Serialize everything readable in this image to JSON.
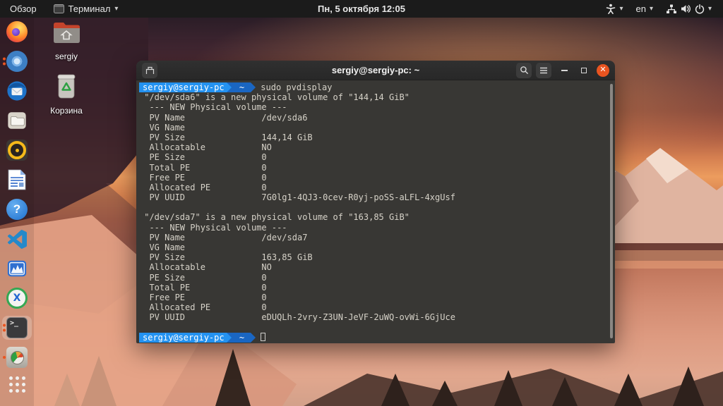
{
  "colors": {
    "accent_orange": "#e95420",
    "prompt_blue_1": "#2492f0",
    "prompt_blue_2": "#1a66c2",
    "terminal_bg": "#383734",
    "topbar_bg": "#1b1b1b"
  },
  "top_bar": {
    "activities_label": "Обзор",
    "focused_app": {
      "icon": "terminal-window-icon",
      "label": "Терминал",
      "caret": "▾"
    },
    "clock": "Пн, 5 октября 12:05",
    "tray": {
      "accessibility_icon": "accessibility-person-icon",
      "accessibility_caret": "▾",
      "language": "en",
      "language_caret": "▾",
      "system_icons": [
        "network-icon",
        "volume-icon",
        "power-icon"
      ],
      "system_caret": "▾"
    }
  },
  "desktop": {
    "icons": [
      {
        "label": "sergiy",
        "icon": "home-folder-icon"
      },
      {
        "label": "Корзина",
        "icon": "trash-icon"
      }
    ]
  },
  "dock": {
    "items": [
      {
        "name": "firefox",
        "icon": "firefox-icon",
        "windows": 0,
        "focused": false
      },
      {
        "name": "chromium",
        "icon": "chromium-icon",
        "windows": 2,
        "focused": false
      },
      {
        "name": "thunderbird",
        "icon": "thunderbird-icon",
        "windows": 0,
        "focused": false
      },
      {
        "name": "files",
        "icon": "files-folder-icon",
        "windows": 0,
        "focused": false
      },
      {
        "name": "rhythmbox",
        "icon": "rhythmbox-icon",
        "windows": 0,
        "focused": false
      },
      {
        "name": "writer",
        "icon": "libreoffice-writer-icon",
        "windows": 0,
        "focused": false
      },
      {
        "name": "help",
        "icon": "help-question-icon",
        "windows": 0,
        "focused": false
      },
      {
        "name": "vscode",
        "icon": "vscode-icon",
        "windows": 0,
        "focused": false
      },
      {
        "name": "system-monitor",
        "icon": "system-monitor-icon",
        "windows": 0,
        "focused": false
      },
      {
        "name": "x-app",
        "icon": "x-app-icon",
        "windows": 0,
        "focused": false
      },
      {
        "name": "terminal",
        "icon": "terminal-icon",
        "windows": 2,
        "focused": true
      },
      {
        "name": "disks",
        "icon": "disks-gauge-icon",
        "windows": 1,
        "focused": false
      },
      {
        "name": "show-apps",
        "icon": "show-applications-grid-icon",
        "windows": 0,
        "focused": false
      }
    ],
    "help_glyph": "?",
    "xapp_glyph": "X",
    "terminal_glyph": ">_"
  },
  "terminal": {
    "title": "sergiy@sergiy-pc: ~",
    "prompt": {
      "user_host": "sergiy@sergiy-pc",
      "cwd": "~"
    },
    "close_glyph": "✕",
    "lines": [
      {
        "t": "cmd",
        "text": "sudo pvdisplay"
      },
      {
        "t": "out",
        "text": " \"/dev/sda6\" is a new physical volume of \"144,14 GiB\""
      },
      {
        "t": "out",
        "text": "  --- NEW Physical volume ---"
      },
      {
        "t": "out",
        "text": "  PV Name               /dev/sda6"
      },
      {
        "t": "out",
        "text": "  VG Name"
      },
      {
        "t": "out",
        "text": "  PV Size               144,14 GiB"
      },
      {
        "t": "out",
        "text": "  Allocatable           NO"
      },
      {
        "t": "out",
        "text": "  PE Size               0"
      },
      {
        "t": "out",
        "text": "  Total PE              0"
      },
      {
        "t": "out",
        "text": "  Free PE               0"
      },
      {
        "t": "out",
        "text": "  Allocated PE          0"
      },
      {
        "t": "out",
        "text": "  PV UUID               7G0lg1-4QJ3-0cev-R0yj-poSS-aLFL-4xgUsf"
      },
      {
        "t": "out",
        "text": ""
      },
      {
        "t": "out",
        "text": " \"/dev/sda7\" is a new physical volume of \"163,85 GiB\""
      },
      {
        "t": "out",
        "text": "  --- NEW Physical volume ---"
      },
      {
        "t": "out",
        "text": "  PV Name               /dev/sda7"
      },
      {
        "t": "out",
        "text": "  VG Name"
      },
      {
        "t": "out",
        "text": "  PV Size               163,85 GiB"
      },
      {
        "t": "out",
        "text": "  Allocatable           NO"
      },
      {
        "t": "out",
        "text": "  PE Size               0"
      },
      {
        "t": "out",
        "text": "  Total PE              0"
      },
      {
        "t": "out",
        "text": "  Free PE               0"
      },
      {
        "t": "out",
        "text": "  Allocated PE          0"
      },
      {
        "t": "out",
        "text": "  PV UUID               eDUQLh-2vry-Z3UN-JeVF-2uWQ-ovWi-6GjUce"
      },
      {
        "t": "out",
        "text": ""
      },
      {
        "t": "cmd",
        "text": "",
        "cursor": true
      }
    ]
  }
}
